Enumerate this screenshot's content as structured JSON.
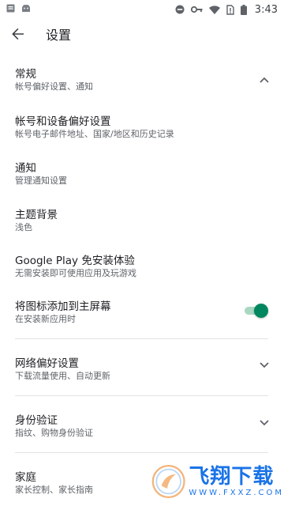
{
  "status_bar": {
    "time": "3:43",
    "icons": [
      "notification-square-icon",
      "android-icon",
      "do-not-disturb-icon",
      "vpn-key-icon",
      "wifi-icon",
      "no-sim-icon",
      "battery-icon"
    ]
  },
  "app_bar": {
    "title": "设置",
    "back_icon": "arrow-back-icon"
  },
  "settings": [
    {
      "title": "常规",
      "subtitle": "帐号偏好设置、通知",
      "control": "chevron-up-icon"
    },
    {
      "title": "帐号和设备偏好设置",
      "subtitle": "帐号电子邮件地址、国家/地区和历史记录"
    },
    {
      "title": "通知",
      "subtitle": "管理通知设置"
    },
    {
      "title": "主题背景",
      "subtitle": "浅色"
    },
    {
      "title": "Google Play 免安装体验",
      "subtitle": "无需安装即可使用应用及玩游戏"
    },
    {
      "title": "将图标添加到主屏幕",
      "subtitle": "在安装新应用时",
      "toggle_on": true
    },
    {
      "title": "网络偏好设置",
      "subtitle": "下载流量使用、自动更新",
      "control": "chevron-down-icon"
    },
    {
      "title": "身份验证",
      "subtitle": "指纹、购物身份验证",
      "control": "chevron-down-icon"
    },
    {
      "title": "家庭",
      "subtitle": "家长控制、家长指南"
    }
  ],
  "watermark": {
    "text": "飞翔下载",
    "subtext": "WWW.FXXZ.COM"
  },
  "colors": {
    "accent": "#01875f",
    "accent_track": "#a8d8c1",
    "watermark": "#1a73e8"
  }
}
